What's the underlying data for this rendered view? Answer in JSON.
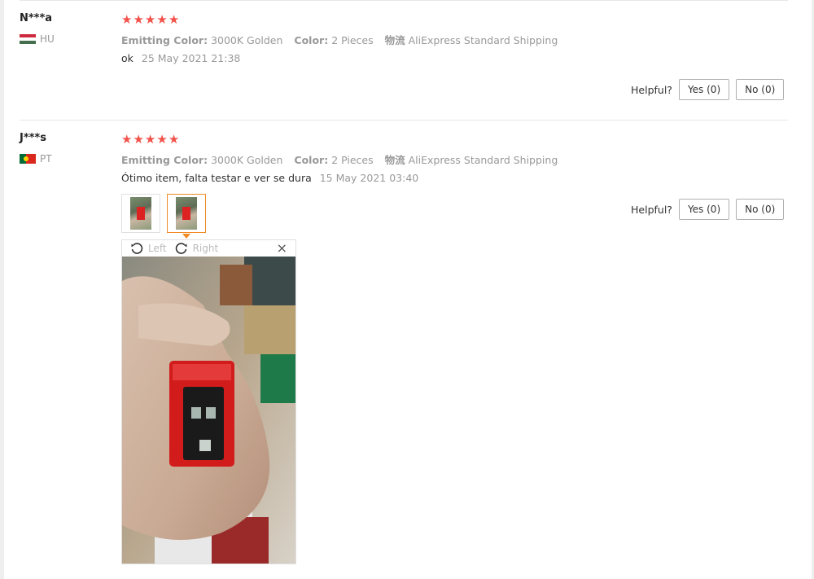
{
  "reviews": [
    {
      "user": "N***a",
      "country": "HU",
      "rating_stars": 5,
      "attributes": {
        "emitting_label": "Emitting Color:",
        "emitting_value": "3000K Golden",
        "color_label": "Color:",
        "color_value": "2 Pieces",
        "shipping_label": "物流",
        "shipping_value": "AliExpress Standard Shipping"
      },
      "text": "ok",
      "date": "25 May 2021 21:38",
      "helpful_label": "Helpful?",
      "yes_label": "Yes (0)",
      "no_label": "No (0)"
    },
    {
      "user": "J***s",
      "country": "PT",
      "rating_stars": 5,
      "attributes": {
        "emitting_label": "Emitting Color:",
        "emitting_value": "3000K Golden",
        "color_label": "Color:",
        "color_value": "2 Pieces",
        "shipping_label": "物流",
        "shipping_value": "AliExpress Standard Shipping"
      },
      "text": "Ótimo item, falta testar e ver se dura",
      "date": "15 May 2021 03:40",
      "helpful_label": "Helpful?",
      "yes_label": "Yes (0)",
      "no_label": "No (0)",
      "viewer": {
        "left_label": "Left",
        "right_label": "Right",
        "close_glyph": "×"
      }
    }
  ],
  "colors": {
    "star": "#f2524a",
    "active_thumb_border": "#f08a24",
    "muted_text": "#999999"
  },
  "icons": {
    "star": "star-icon",
    "rotate_left": "rotate-left-icon",
    "rotate_right": "rotate-right-icon",
    "close": "close-icon"
  }
}
